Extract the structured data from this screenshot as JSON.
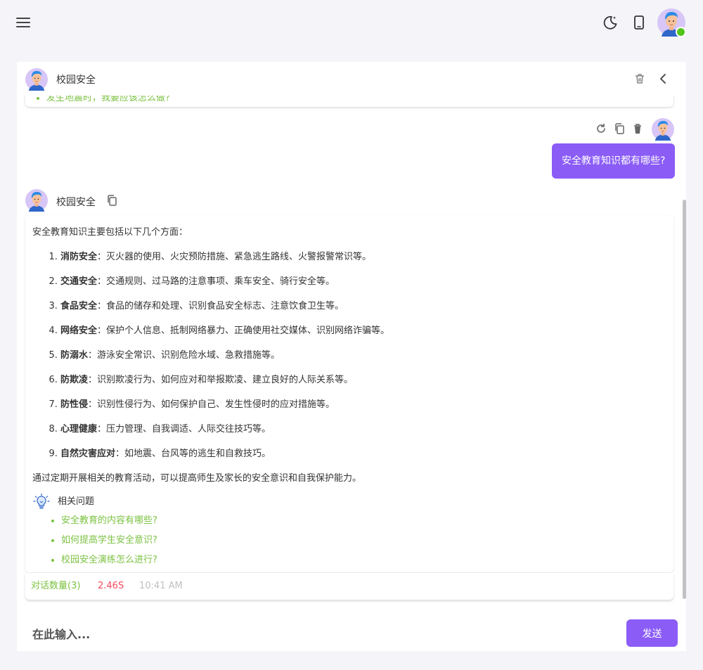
{
  "topbar": {
    "menu_icon": "menu-icon",
    "theme_icon": "moon-icon",
    "device_icon": "phone-icon",
    "avatar_status": "online"
  },
  "chat_header": {
    "title": "校园安全",
    "actions": [
      "trash-icon",
      "chevron-left-icon"
    ]
  },
  "previous_card": {
    "text": "发生地震时，我要应该怎么做?"
  },
  "user_message": {
    "text": "安全教育知识都有哪些?",
    "actions": [
      "refresh-icon",
      "copy-icon",
      "delete-icon"
    ]
  },
  "bot_message": {
    "name": "校园安全",
    "intro": "安全教育知识主要包括以下几个方面：",
    "points": [
      {
        "term": "消防安全",
        "desc": "：灭火器的使用、火灾预防措施、紧急逃生路线、火警报警常识等。"
      },
      {
        "term": "交通安全",
        "desc": "：交通规则、过马路的注意事项、乘车安全、骑行安全等。"
      },
      {
        "term": "食品安全",
        "desc": "：食品的储存和处理、识别食品安全标志、注意饮食卫生等。"
      },
      {
        "term": "网络安全",
        "desc": "：保护个人信息、抵制网络暴力、正确使用社交媒体、识别网络诈骗等。"
      },
      {
        "term": "防溺水",
        "desc": "：游泳安全常识、识别危险水域、急救措施等。"
      },
      {
        "term": "防欺凌",
        "desc": "：识别欺凌行为、如何应对和举报欺凌、建立良好的人际关系等。"
      },
      {
        "term": "防性侵",
        "desc": "：识别性侵行为、如何保护自己、发生性侵时的应对措施等。"
      },
      {
        "term": "心理健康",
        "desc": "：压力管理、自我调适、人际交往技巧等。"
      },
      {
        "term": "自然灾害应对",
        "desc": "：如地震、台风等的逃生和自救技巧。"
      }
    ],
    "outro": "通过定期开展相关的教育活动，可以提高师生及家长的安全意识和自我保护能力。",
    "related_label": "相关问题",
    "related": [
      "安全教育的内容有哪些?",
      "如何提高学生安全意识?",
      "校园安全演练怎么进行?"
    ]
  },
  "stats": {
    "count": "对话数量(3)",
    "duration": "2.46S",
    "time": "10:41 AM"
  },
  "composer": {
    "placeholder": "在此输入...",
    "send_label": "发送"
  },
  "colors": {
    "accent": "#8b5cf6",
    "link_green": "#7cc242",
    "duration_red": "#f5485d",
    "online": "#52c41a",
    "background": "#f4f4f9"
  }
}
